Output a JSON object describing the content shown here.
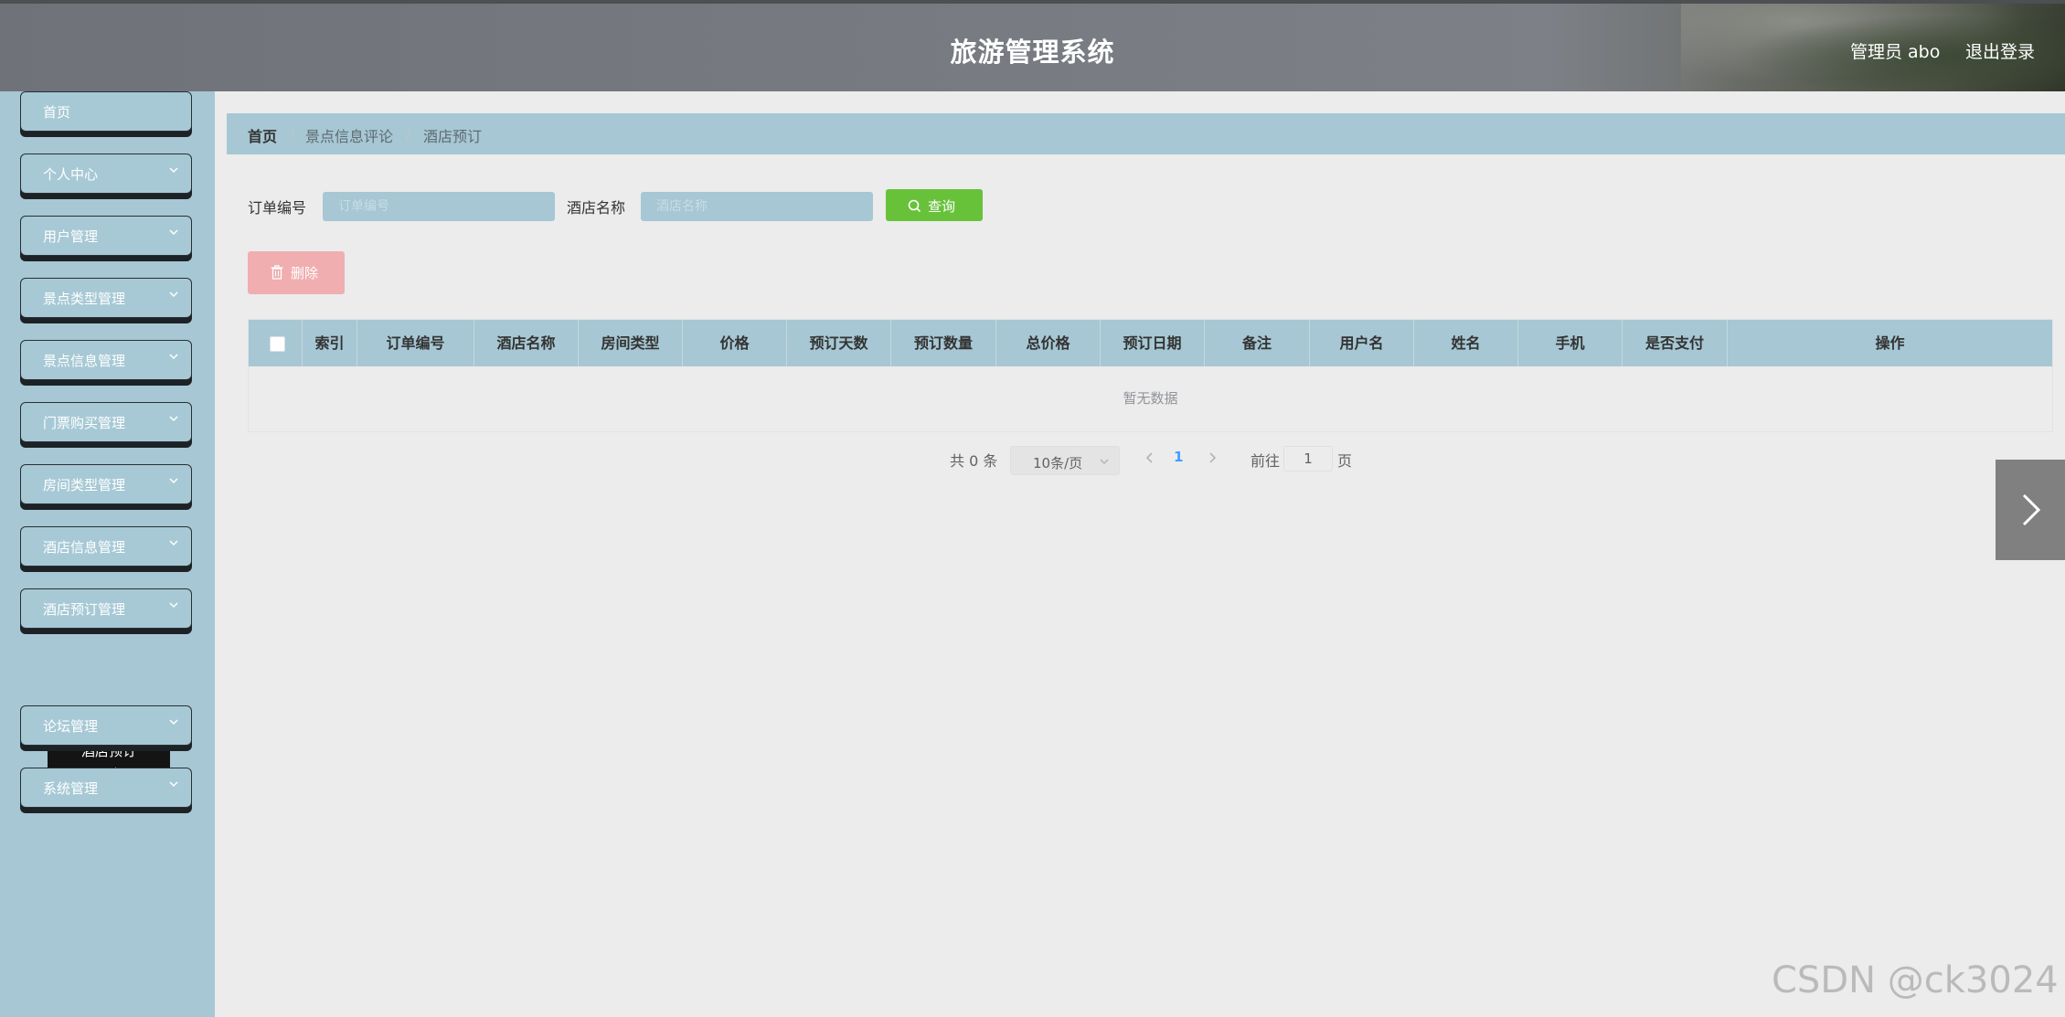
{
  "header": {
    "title": "旅游管理系统",
    "user_label": "管理员 abo",
    "logout_label": "退出登录"
  },
  "sidebar": {
    "items": [
      {
        "label": "首页",
        "has_submenu": false
      },
      {
        "label": "个人中心",
        "has_submenu": true
      },
      {
        "label": "用户管理",
        "has_submenu": true
      },
      {
        "label": "景点类型管理",
        "has_submenu": true
      },
      {
        "label": "景点信息管理",
        "has_submenu": true
      },
      {
        "label": "门票购买管理",
        "has_submenu": true
      },
      {
        "label": "房间类型管理",
        "has_submenu": true
      },
      {
        "label": "酒店信息管理",
        "has_submenu": true
      },
      {
        "label": "酒店预订管理",
        "has_submenu": true
      },
      {
        "label": "论坛管理",
        "has_submenu": true
      },
      {
        "label": "系统管理",
        "has_submenu": true
      }
    ],
    "submenu_popup": "酒店预订"
  },
  "breadcrumb": {
    "items": [
      "首页",
      "景点信息评论",
      "酒店预订"
    ],
    "separator": "/"
  },
  "search": {
    "order_no_label": "订单编号",
    "order_no_placeholder": "订单编号",
    "order_no_value": "",
    "hotel_name_label": "酒店名称",
    "hotel_name_placeholder": "酒店名称",
    "hotel_name_value": "",
    "query_button": "查询",
    "query_icon": "search-icon"
  },
  "actions": {
    "delete_button": "删除",
    "delete_icon": "trash-icon"
  },
  "table": {
    "columns": [
      "索引",
      "订单编号",
      "酒店名称",
      "房间类型",
      "价格",
      "预订天数",
      "预订数量",
      "总价格",
      "预订日期",
      "备注",
      "用户名",
      "姓名",
      "手机",
      "是否支付",
      "操作"
    ],
    "rows": [],
    "empty_text": "暂无数据"
  },
  "pagination": {
    "total_label": "共 0 条",
    "page_size": "10条/页",
    "current_page": "1",
    "goto_label": "前往",
    "goto_value": "1",
    "page_suffix": "页"
  },
  "watermark": "CSDN @ck3024",
  "colors": {
    "header": "#7a7e84",
    "sidebar": "#a6c7d3",
    "content_bg": "#ececec",
    "search_button": "#67c23a",
    "delete_button": "#f0aeb0",
    "active_page": "#409eff"
  }
}
